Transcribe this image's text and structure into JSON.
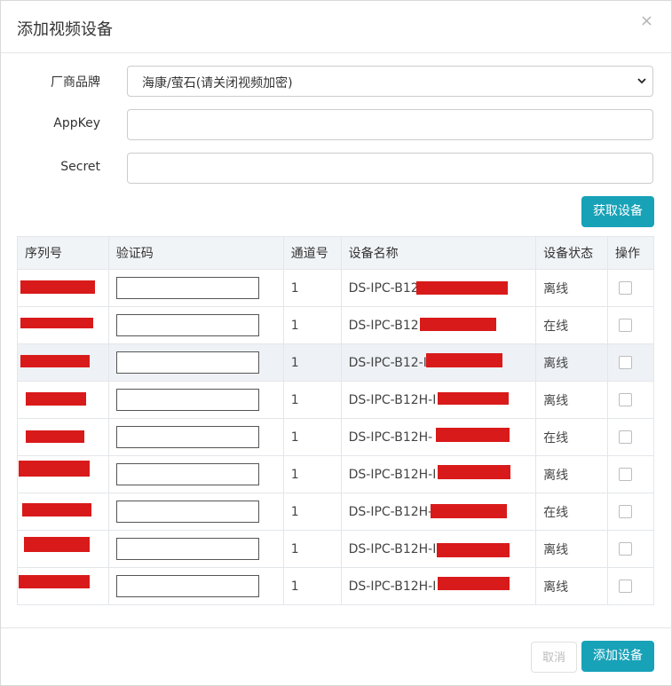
{
  "dialog": {
    "title": "添加视频设备",
    "close_glyph": "×"
  },
  "form": {
    "brand_label": "厂商品牌",
    "brand_value": "海康/萤石(请关闭视频加密)",
    "appkey_label": "AppKey",
    "appkey_value": "",
    "secret_label": "Secret",
    "secret_value": "",
    "fetch_button": "获取设备"
  },
  "table": {
    "headers": [
      "序列号",
      "验证码",
      "通道号",
      "设备名称",
      "设备状态",
      "操作"
    ],
    "rows": [
      {
        "serial": "",
        "code": "",
        "channel": "1",
        "name": "DS-IPC-B12",
        "status": "离线"
      },
      {
        "serial": "",
        "code": "",
        "channel": "1",
        "name": "DS-IPC-B12",
        "status": "在线"
      },
      {
        "serial": "",
        "code": "",
        "channel": "1",
        "name": "DS-IPC-B12-I",
        "status": "离线"
      },
      {
        "serial": "",
        "code": "",
        "channel": "1",
        "name": "DS-IPC-B12H-I",
        "status": "离线"
      },
      {
        "serial": "",
        "code": "",
        "channel": "1",
        "name": "DS-IPC-B12H-",
        "status": "在线"
      },
      {
        "serial": "",
        "code": "",
        "channel": "1",
        "name": "DS-IPC-B12H-I",
        "status": "离线"
      },
      {
        "serial": "",
        "code": "",
        "channel": "1",
        "name": "DS-IPC-B12H-",
        "status": "在线"
      },
      {
        "serial": "",
        "code": "",
        "channel": "1",
        "name": "DS-IPC-B12H-I",
        "status": "离线"
      },
      {
        "serial": "",
        "code": "",
        "channel": "1",
        "name": "DS-IPC-B12H-I",
        "status": "离线"
      }
    ]
  },
  "footer": {
    "cancel_button": "取消",
    "add_button": "添加设备"
  },
  "colors": {
    "primary": "#17a2b8",
    "redaction": "#d91a1a"
  }
}
